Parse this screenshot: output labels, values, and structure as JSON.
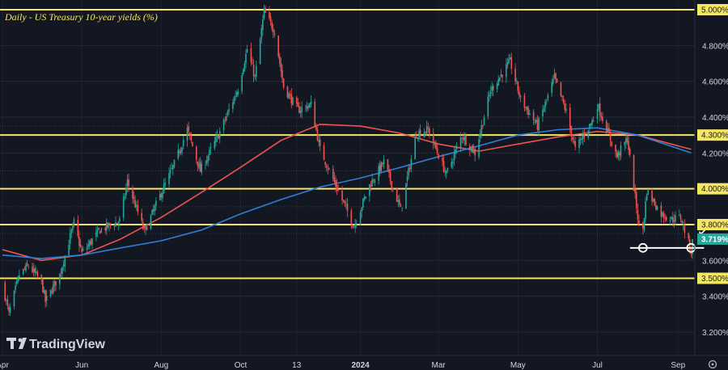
{
  "chart_data": {
    "type": "candlestick",
    "title": "Daily - US Treasury 10-year yields (%)",
    "brand": "TradingView",
    "ylim": [
      3.12,
      5.06
    ],
    "y_ticks": [
      "5.000%",
      "4.800%",
      "4.600%",
      "4.400%",
      "4.200%",
      "4.000%",
      "3.800%",
      "3.600%",
      "3.400%",
      "3.200%"
    ],
    "y_tick_values": [
      5.0,
      4.8,
      4.6,
      4.4,
      4.2,
      4.0,
      3.8,
      3.6,
      3.4,
      3.2
    ],
    "x_tick_labels": [
      "Apr",
      "Jun",
      "Aug",
      "Oct",
      "13",
      "2024",
      "Mar",
      "May",
      "Jul",
      "Sep"
    ],
    "x_tick_dates": [
      "2023-04-01",
      "2023-06-01",
      "2023-08-01",
      "2023-10-01",
      "2023-11-13",
      "2024-01-01",
      "2024-03-01",
      "2024-05-01",
      "2024-07-01",
      "2024-09-01"
    ],
    "date_range": [
      "2023-04-01",
      "2024-09-12"
    ],
    "horizontal_levels": [
      {
        "value": 5.0,
        "label": "5.000%",
        "color": "#f5e663"
      },
      {
        "value": 4.3,
        "label": "4.300%",
        "color": "#f5e663"
      },
      {
        "value": 4.0,
        "label": "4.000%",
        "color": "#f5e663"
      },
      {
        "value": 3.8,
        "label": "3.800%",
        "color": "#f5e663"
      },
      {
        "value": 3.5,
        "label": "3.500%",
        "color": "#f5e663"
      }
    ],
    "support_line": {
      "value": 3.67,
      "from": "2024-08-05",
      "to": "2024-09-11",
      "color": "#ffffff"
    },
    "last_price": {
      "value": 3.719,
      "label": "3.719%",
      "color": "#26a69a"
    },
    "candle_colors": {
      "up": "#26a69a",
      "down": "#ef5350"
    },
    "moving_averages": [
      {
        "color": "#ef5350",
        "points": [
          [
            "2023-04-01",
            3.66
          ],
          [
            "2023-05-01",
            3.6
          ],
          [
            "2023-06-01",
            3.63
          ],
          [
            "2023-07-01",
            3.72
          ],
          [
            "2023-08-01",
            3.84
          ],
          [
            "2023-09-01",
            3.98
          ],
          [
            "2023-10-01",
            4.12
          ],
          [
            "2023-11-01",
            4.27
          ],
          [
            "2023-12-01",
            4.36
          ],
          [
            "2024-01-01",
            4.35
          ],
          [
            "2024-02-01",
            4.31
          ],
          [
            "2024-03-01",
            4.25
          ],
          [
            "2024-04-01",
            4.21
          ],
          [
            "2024-05-01",
            4.25
          ],
          [
            "2024-06-01",
            4.29
          ],
          [
            "2024-07-01",
            4.32
          ],
          [
            "2024-08-01",
            4.3
          ],
          [
            "2024-09-11",
            4.22
          ]
        ]
      },
      {
        "color": "#2f7ed8",
        "points": [
          [
            "2023-04-01",
            3.63
          ],
          [
            "2023-05-01",
            3.61
          ],
          [
            "2023-06-01",
            3.63
          ],
          [
            "2023-07-01",
            3.67
          ],
          [
            "2023-08-01",
            3.71
          ],
          [
            "2023-09-01",
            3.77
          ],
          [
            "2023-10-01",
            3.86
          ],
          [
            "2023-11-01",
            3.94
          ],
          [
            "2023-12-01",
            4.01
          ],
          [
            "2024-01-01",
            4.06
          ],
          [
            "2024-02-01",
            4.12
          ],
          [
            "2024-03-01",
            4.18
          ],
          [
            "2024-04-01",
            4.24
          ],
          [
            "2024-05-01",
            4.3
          ],
          [
            "2024-06-01",
            4.33
          ],
          [
            "2024-07-01",
            4.34
          ],
          [
            "2024-08-01",
            4.3
          ],
          [
            "2024-09-11",
            4.2
          ]
        ]
      }
    ],
    "price_path": [
      [
        "2023-04-01",
        3.47
      ],
      [
        "2023-04-06",
        3.3
      ],
      [
        "2023-04-14",
        3.52
      ],
      [
        "2023-04-21",
        3.57
      ],
      [
        "2023-05-01",
        3.48
      ],
      [
        "2023-05-04",
        3.37
      ],
      [
        "2023-05-15",
        3.52
      ],
      [
        "2023-05-26",
        3.81
      ],
      [
        "2023-06-01",
        3.64
      ],
      [
        "2023-06-15",
        3.77
      ],
      [
        "2023-06-30",
        3.82
      ],
      [
        "2023-07-06",
        4.04
      ],
      [
        "2023-07-19",
        3.76
      ],
      [
        "2023-07-31",
        3.96
      ],
      [
        "2023-08-10",
        4.12
      ],
      [
        "2023-08-21",
        4.33
      ],
      [
        "2023-08-31",
        4.1
      ],
      [
        "2023-09-14",
        4.3
      ],
      [
        "2023-09-29",
        4.56
      ],
      [
        "2023-10-06",
        4.78
      ],
      [
        "2023-10-12",
        4.62
      ],
      [
        "2023-10-19",
        4.99
      ],
      [
        "2023-10-27",
        4.88
      ],
      [
        "2023-11-03",
        4.57
      ],
      [
        "2023-11-14",
        4.44
      ],
      [
        "2023-11-24",
        4.47
      ],
      [
        "2023-12-01",
        4.22
      ],
      [
        "2023-12-13",
        4.02
      ],
      [
        "2023-12-27",
        3.79
      ],
      [
        "2024-01-08",
        4.02
      ],
      [
        "2024-01-19",
        4.15
      ],
      [
        "2024-02-01",
        3.88
      ],
      [
        "2024-02-13",
        4.31
      ],
      [
        "2024-02-22",
        4.33
      ],
      [
        "2024-03-07",
        4.08
      ],
      [
        "2024-03-19",
        4.3
      ],
      [
        "2024-03-29",
        4.2
      ],
      [
        "2024-04-10",
        4.55
      ],
      [
        "2024-04-25",
        4.71
      ],
      [
        "2024-05-03",
        4.5
      ],
      [
        "2024-05-16",
        4.35
      ],
      [
        "2024-05-29",
        4.62
      ],
      [
        "2024-06-07",
        4.43
      ],
      [
        "2024-06-14",
        4.22
      ],
      [
        "2024-06-28",
        4.39
      ],
      [
        "2024-07-01",
        4.47
      ],
      [
        "2024-07-16",
        4.18
      ],
      [
        "2024-07-24",
        4.28
      ],
      [
        "2024-08-02",
        3.79
      ],
      [
        "2024-08-05",
        3.78
      ],
      [
        "2024-08-08",
        3.99
      ],
      [
        "2024-08-19",
        3.86
      ],
      [
        "2024-08-27",
        3.83
      ],
      [
        "2024-09-03",
        3.84
      ],
      [
        "2024-09-11",
        3.65
      ],
      [
        "2024-09-12",
        3.72
      ]
    ]
  }
}
